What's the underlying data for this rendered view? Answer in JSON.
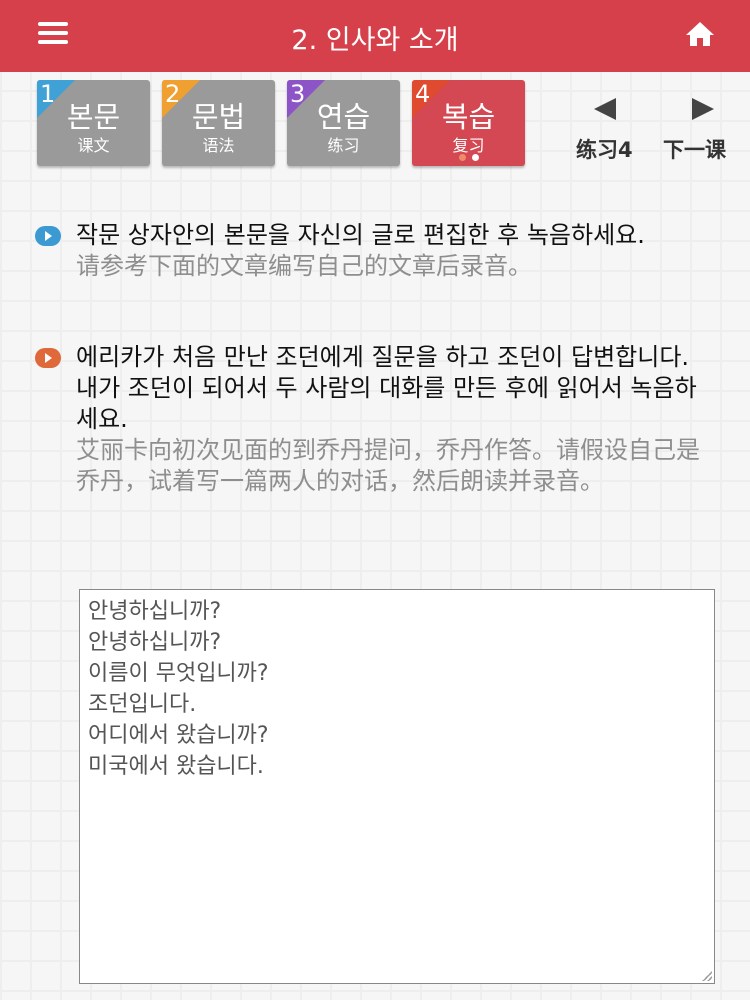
{
  "header": {
    "title": "2. 인사와 소개",
    "menu_icon": "hamburger-menu-icon",
    "home_icon": "home-icon",
    "color": "#d5404b"
  },
  "tabs": [
    {
      "number": "1",
      "label_ko": "본문",
      "label_zh": "课文",
      "corner_color": "#3fa1d6"
    },
    {
      "number": "2",
      "label_ko": "문법",
      "label_zh": "语法",
      "corner_color": "#f0a030"
    },
    {
      "number": "3",
      "label_ko": "연습",
      "label_zh": "练习",
      "corner_color": "#8d54c8"
    },
    {
      "number": "4",
      "label_ko": "복습",
      "label_zh": "复习",
      "corner_color": "#e04a2e",
      "active": true
    }
  ],
  "navigation": {
    "prev_label": "练习4",
    "next_label": "下一课"
  },
  "instructions": [
    {
      "icon": "chevron-right-icon",
      "ko": "작문 상자안의 본문을 자신의 글로 편집한 후 녹음하세요.",
      "zh": "请参考下面的文章编写自己的文章后录音。"
    },
    {
      "icon": "play-icon",
      "ko_lines": [
        "에리카가 처음 만난 조던에게 질문을 하고 조던이 답변합니다.",
        "내가 조던이 되어서 두 사람의 대화를 만든 후에 읽어서 녹음하세요."
      ],
      "zh": "艾丽卡向初次见面的到乔丹提问，乔丹作答。请假设自己是乔丹，试着写一篇两人的对话，然后朗读并录音。"
    }
  ],
  "answer_box": {
    "lines": [
      "안녕하십니까?",
      "안녕하십니까?",
      "이름이 무엇입니까?",
      "조던입니다.",
      "어디에서 왔습니까?",
      "미국에서 왔습니다."
    ]
  }
}
